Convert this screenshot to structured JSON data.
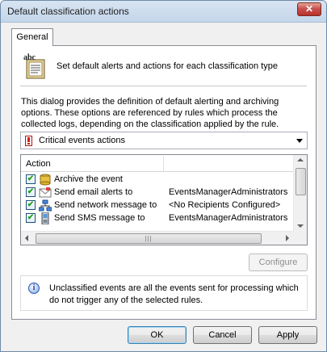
{
  "window": {
    "title": "Default classification actions",
    "close_label": "✕"
  },
  "tabs": [
    {
      "label": "General"
    }
  ],
  "header": {
    "text": "Set default alerts and actions for each classification type"
  },
  "description": "This dialog provides the definition of default alerting and archiving options. These options are referenced by rules which process the collected logs, depending on the classification applied by the rule.",
  "classification_select": {
    "selected": "Critical events actions"
  },
  "actions_list": {
    "columns": [
      "Action",
      ""
    ],
    "rows": [
      {
        "checked": true,
        "icon": "archive-icon",
        "label": "Archive the event",
        "value": ""
      },
      {
        "checked": true,
        "icon": "email-icon",
        "label": "Send email alerts to",
        "value": "EventsManagerAdministrators"
      },
      {
        "checked": true,
        "icon": "network-icon",
        "label": "Send network message to",
        "value": "<No Recipients Configured>"
      },
      {
        "checked": true,
        "icon": "mobile-phone-icon",
        "label": "Send SMS message to",
        "value": "EventsManagerAdministrators"
      }
    ]
  },
  "configure_button": "Configure",
  "info": {
    "text": "Unclassified events are all the events sent for processing which do not trigger any of the selected rules."
  },
  "buttons": {
    "ok": "OK",
    "cancel": "Cancel",
    "apply": "Apply"
  }
}
